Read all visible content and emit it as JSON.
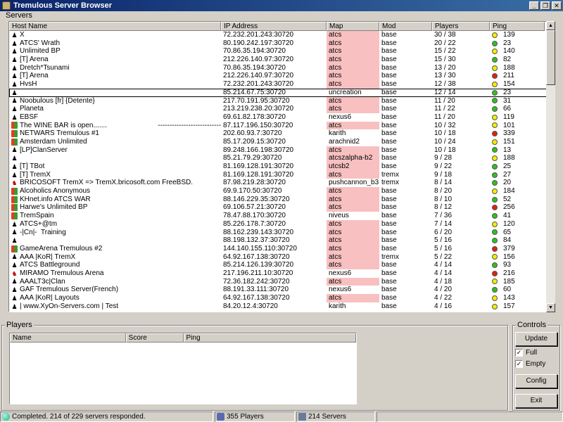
{
  "window": {
    "title": "Tremulous Server Browser",
    "controls": [
      "_",
      "❐",
      "✕"
    ]
  },
  "servers": {
    "group_label": "Servers",
    "columns": [
      "Host Name",
      "IP Address",
      "Map",
      "Mod",
      "Players",
      "Ping"
    ],
    "rows": [
      {
        "os": "linux",
        "host": "X",
        "ip": "72.232.201.243:30720",
        "map": "atcs",
        "map_hl": true,
        "mod": "base",
        "players": "30 / 38",
        "ping": "139",
        "ping_status": "yellow"
      },
      {
        "os": "linux",
        "host": "ATCS' Wrath",
        "ip": "80.190.242.197:30720",
        "map": "atcs",
        "map_hl": true,
        "mod": "base",
        "players": "20 / 22",
        "ping": "23",
        "ping_status": "green"
      },
      {
        "os": "linux",
        "host": "Unlimited BP",
        "ip": "70.86.35.194:30720",
        "map": "atcs",
        "map_hl": true,
        "mod": "base",
        "players": "15 / 22",
        "ping": "140",
        "ping_status": "yellow"
      },
      {
        "os": "linux",
        "host": "[T] Arena",
        "ip": "212.226.140.97:30720",
        "map": "atcs",
        "map_hl": true,
        "mod": "base",
        "players": "15 / 30",
        "ping": "82",
        "ping_status": "green"
      },
      {
        "os": "linux",
        "host": "Dretch*Tsunami",
        "ip": "70.86.35.194:30720",
        "map": "atcs",
        "map_hl": true,
        "mod": "base",
        "players": "13 / 20",
        "ping": "188",
        "ping_status": "yellow"
      },
      {
        "os": "linux",
        "host": "[T] Arena",
        "ip": "212.226.140.97:30720",
        "map": "atcs",
        "map_hl": true,
        "mod": "base",
        "players": "13 / 30",
        "ping": "211",
        "ping_status": "red"
      },
      {
        "os": "linux",
        "host": "HvsH",
        "ip": "72.232.201.243:30720",
        "map": "atcs",
        "map_hl": true,
        "mod": "base",
        "players": "12 / 38",
        "ping": "154",
        "ping_status": "yellow"
      },
      {
        "os": "linux",
        "host": "",
        "ip": "85.214.67.75:30720",
        "map": "uncreation",
        "map_hl": false,
        "mod": "base",
        "players": "12 / 14",
        "ping": "23",
        "ping_status": "green",
        "selected": true
      },
      {
        "os": "linux",
        "host": "Noobulous [fr] {Detente}",
        "ip": "217.70.191.95:30720",
        "map": "atcs",
        "map_hl": true,
        "mod": "base",
        "players": "11 / 20",
        "ping": "31",
        "ping_status": "green"
      },
      {
        "os": "linux",
        "host": "Planeta",
        "ip": "213.219.238.20:30720",
        "map": "atcs",
        "map_hl": true,
        "mod": "base",
        "players": "11 / 22",
        "ping": "66",
        "ping_status": "green"
      },
      {
        "os": "linux",
        "host": "EBSF",
        "ip": "69.61.82.178:30720",
        "map": "nexus6",
        "map_hl": false,
        "mod": "base",
        "players": "11 / 20",
        "ping": "119",
        "ping_status": "yellow"
      },
      {
        "os": "windows",
        "host": "The WINE BAR is open.......                          ---------------------------------           .....",
        "ip": "87.117.196.150:30720",
        "map": "atcs",
        "map_hl": true,
        "mod": "base",
        "players": "10 / 32",
        "ping": "101",
        "ping_status": "yellow"
      },
      {
        "os": "windows",
        "host": "NETWARS Tremulous #1",
        "ip": "202.60.93.7:30720",
        "map": "karith",
        "map_hl": false,
        "mod": "base",
        "players": "10 / 18",
        "ping": "339",
        "ping_status": "red"
      },
      {
        "os": "windows",
        "host": "Amsterdam Unlimited",
        "ip": "85.17.209.15:30720",
        "map": "arachnid2",
        "map_hl": false,
        "mod": "base",
        "players": "10 / 24",
        "ping": "151",
        "ping_status": "yellow"
      },
      {
        "os": "linux",
        "host": "[LP]ClanServer",
        "ip": "89.248.166.198:30720",
        "map": "atcs",
        "map_hl": true,
        "mod": "base",
        "players": "10 / 18",
        "ping": "13",
        "ping_status": "green"
      },
      {
        "os": "linux",
        "host": "",
        "ip": "85.21.79.29:30720",
        "map": "atcszalpha-b2",
        "map_hl": true,
        "mod": "base",
        "players": "9 / 28",
        "ping": "188",
        "ping_status": "yellow"
      },
      {
        "os": "linux",
        "host": "[T] TBot",
        "ip": "81.169.128.191:30720",
        "map": "utcsb2",
        "map_hl": true,
        "mod": "base",
        "players": "9 / 22",
        "ping": "25",
        "ping_status": "green"
      },
      {
        "os": "linux",
        "host": "[T] TremX",
        "ip": "81.169.128.191:30720",
        "map": "atcs",
        "map_hl": true,
        "mod": "tremx",
        "players": "9 / 18",
        "ping": "27",
        "ping_status": "green"
      },
      {
        "os": "freebsd",
        "host": "BRICOSOFT TremX => TremX.bricosoft.com FreeBSD.",
        "ip": "87.98.219.28:30720",
        "map": "pushcannon_b3",
        "map_hl": false,
        "mod": "tremx",
        "players": "8 / 14",
        "ping": "20",
        "ping_status": "green"
      },
      {
        "os": "windows",
        "host": "Alcoholics Anonymous",
        "ip": "69.9.170.50:30720",
        "map": "atcs",
        "map_hl": true,
        "mod": "base",
        "players": "8 / 20",
        "ping": "184",
        "ping_status": "yellow"
      },
      {
        "os": "windows",
        "host": "KHnet.info ATCS WAR",
        "ip": "88.146.229.35:30720",
        "map": "atcs",
        "map_hl": true,
        "mod": "base",
        "players": "8 / 10",
        "ping": "52",
        "ping_status": "green"
      },
      {
        "os": "windows",
        "host": "Harwe's Unlimited BP",
        "ip": "69.106.57.21:30720",
        "map": "atcs",
        "map_hl": true,
        "mod": "base",
        "players": "8 / 12",
        "ping": "256",
        "ping_status": "red"
      },
      {
        "os": "windows",
        "host": "TremSpain",
        "ip": "78.47.88.170:30720",
        "map": "niveus",
        "map_hl": false,
        "mod": "base",
        "players": "7 / 36",
        "ping": "41",
        "ping_status": "green"
      },
      {
        "os": "linux",
        "host": "ATCS+@tm",
        "ip": "85.226.178.7:30720",
        "map": "atcs",
        "map_hl": true,
        "mod": "base",
        "players": "7 / 14",
        "ping": "120",
        "ping_status": "yellow"
      },
      {
        "os": "linux",
        "host": "-|Cn|-  Training",
        "ip": "88.162.239.143:30720",
        "map": "atcs",
        "map_hl": true,
        "mod": "base",
        "players": "6 / 20",
        "ping": "65",
        "ping_status": "green"
      },
      {
        "os": "linux",
        "host": "",
        "ip": "88.198.132.37:30720",
        "map": "atcs",
        "map_hl": true,
        "mod": "base",
        "players": "5 / 16",
        "ping": "84",
        "ping_status": "green"
      },
      {
        "os": "windows",
        "host": "GameArena Tremulous #2",
        "ip": "144.140.155.110:30720",
        "map": "atcs",
        "map_hl": true,
        "mod": "base",
        "players": "5 / 16",
        "ping": "379",
        "ping_status": "red"
      },
      {
        "os": "linux",
        "host": "AAA |KoR| TremX",
        "ip": "64.92.167.138:30720",
        "map": "atcs",
        "map_hl": true,
        "mod": "tremx",
        "players": "5 / 22",
        "ping": "156",
        "ping_status": "yellow"
      },
      {
        "os": "linux",
        "host": "ATCS Battleground",
        "ip": "85.214.126.139:30720",
        "map": "atcs",
        "map_hl": true,
        "mod": "base",
        "players": "4 / 14",
        "ping": "93",
        "ping_status": "green"
      },
      {
        "os": "freebsd",
        "host": "MIRAMO Tremulous Arena",
        "ip": "217.196.211.10:30720",
        "map": "nexus6",
        "map_hl": false,
        "mod": "base",
        "players": "4 / 14",
        "ping": "216",
        "ping_status": "red"
      },
      {
        "os": "linux",
        "host": "AAALT3c|Clan",
        "ip": "72.36.182.242:30720",
        "map": "atcs",
        "map_hl": true,
        "mod": "base",
        "players": "4 / 18",
        "ping": "185",
        "ping_status": "yellow"
      },
      {
        "os": "linux",
        "host": "GAF Tremulous Server(French)",
        "ip": "88.191.33.111:30720",
        "map": "nexus6",
        "map_hl": false,
        "mod": "base",
        "players": "4 / 20",
        "ping": "60",
        "ping_status": "green"
      },
      {
        "os": "linux",
        "host": "AAA |KoR| Layouts",
        "ip": "64.92.167.138:30720",
        "map": "atcs",
        "map_hl": true,
        "mod": "base",
        "players": "4 / 22",
        "ping": "143",
        "ping_status": "yellow"
      },
      {
        "os": "linux",
        "host": "| www.XyOn-Servers.com | Test",
        "ip": "84.20.12.4:30720",
        "map": "karith",
        "map_hl": false,
        "mod": "base",
        "players": "4 / 16",
        "ping": "157",
        "ping_status": "yellow"
      }
    ]
  },
  "players": {
    "group_label": "Players",
    "columns": [
      "Name",
      "Score",
      "Ping"
    ]
  },
  "controls": {
    "group_label": "Controls",
    "update_label": "Update",
    "full_label": "Full",
    "full_checked": true,
    "empty_label": "Empty",
    "empty_checked": true,
    "config_label": "Config",
    "exit_label": "Exit"
  },
  "status": {
    "message": "Completed. 214 of 229 servers responded.",
    "players": "355 Players",
    "servers": "214 Servers"
  },
  "colors": {
    "map_highlight": "#f8c0c0",
    "ping_green": "#30c020",
    "ping_yellow": "#f0f000",
    "ping_red": "#e02010",
    "titlebar": "#0a246a"
  }
}
